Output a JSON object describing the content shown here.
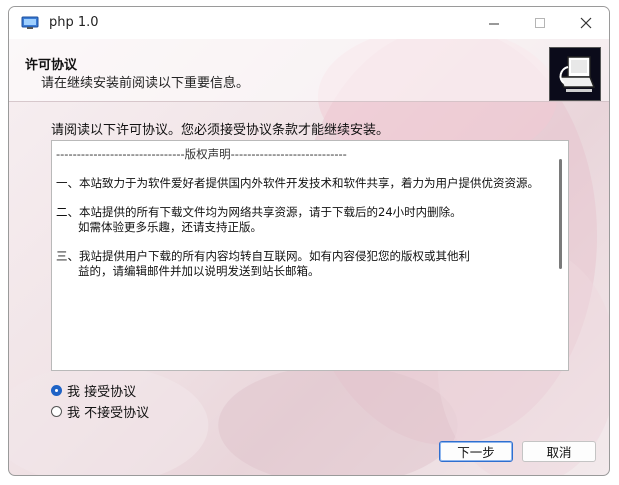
{
  "window": {
    "title": "php 1.0"
  },
  "header": {
    "title": "许可协议",
    "subtitle": "请在继续安装前阅读以下重要信息。"
  },
  "instruction": "请阅读以下许可协议。您必须接受协议条款才能继续安装。",
  "license": {
    "separator": "-------------------------------版权声明----------------------------",
    "paragraphs": [
      {
        "text": "一、本站致力于为软件爱好者提供国内外软件开发技术和软件共享，着力为用户提供优资资源。",
        "indent": ""
      },
      {
        "text": "二、本站提供的所有下载文件均为网络共享资源，请于下载后的24小时内删除。",
        "indent": "如需体验更多乐趣，还请支持正版。"
      },
      {
        "text": "三、我站提供用户下载的所有内容均转自互联网。如有内容侵犯您的版权或其他利",
        "indent": "益的，请编辑邮件并加以说明发送到站长邮箱。"
      }
    ]
  },
  "options": {
    "accept": "我 接受协议",
    "decline": "我 不接受协议",
    "selected": "accept"
  },
  "buttons": {
    "next": "下一步",
    "cancel": "取消"
  },
  "icons": {
    "app": "installer-icon",
    "minimize": "minimize-icon",
    "maximize": "maximize-icon",
    "close": "close-icon",
    "logo": "setup-computer-icon"
  },
  "colors": {
    "accent": "#1f63c6",
    "header_bg": "#ffffff",
    "logo_bg": "#0b0b1a"
  }
}
